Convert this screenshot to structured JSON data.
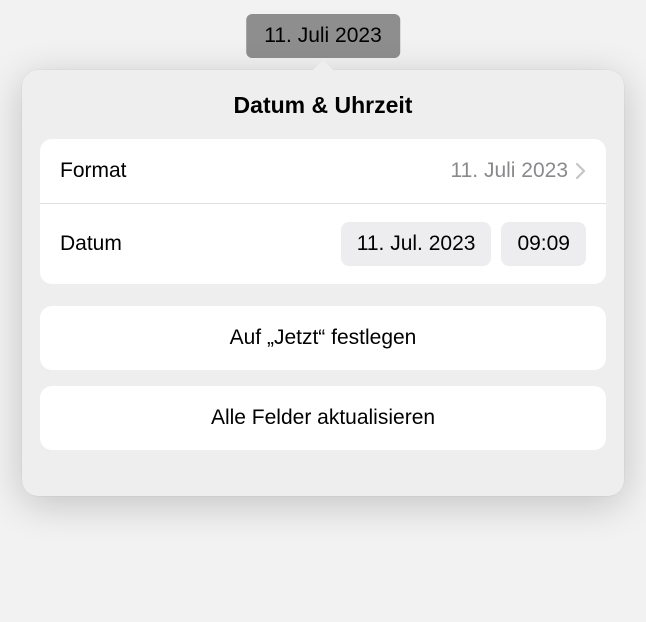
{
  "field": {
    "display": "11. Juli 2023"
  },
  "popover": {
    "title": "Datum & Uhrzeit",
    "format": {
      "label": "Format",
      "value": "11. Juli 2023"
    },
    "date": {
      "label": "Datum",
      "dateValue": "11. Jul. 2023",
      "timeValue": "09:09"
    },
    "setNow": "Auf „Jetzt“ festlegen",
    "updateAll": "Alle Felder aktualisieren"
  }
}
